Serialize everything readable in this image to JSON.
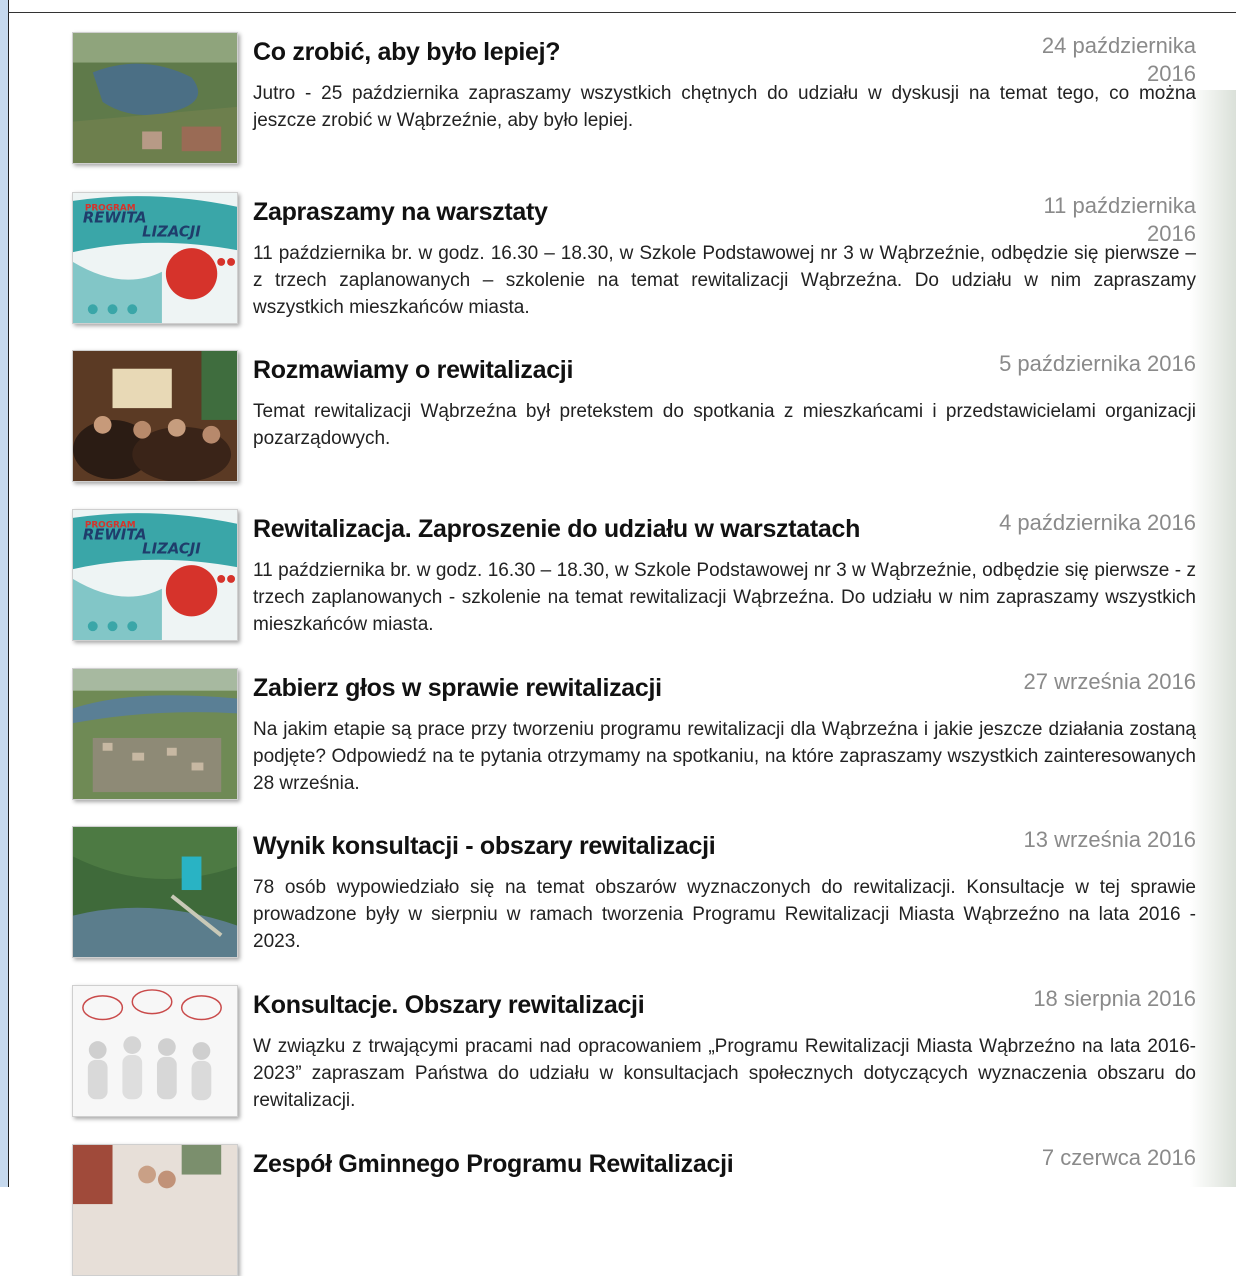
{
  "news": [
    {
      "title": "Co zrobić, aby było lepiej?",
      "date": "24 października 2016",
      "excerpt": "Jutro - 25 października zapraszamy wszystkich chętnych do udziału w dyskusji na temat tego, co można jeszcze zrobić w Wąbrzeźnie, aby było lepiej.",
      "thumbnail": "aerial-lake-town"
    },
    {
      "title": "Zapraszamy na warsztaty",
      "date": "11 października 2016",
      "excerpt": "11 października br. w godz. 16.30 – 18.30, w Szkole Podstawowej nr 3 w Wąbrzeźnie, odbędzie się pierwsze – z trzech zaplanowanych – szkolenie na temat rewitalizacji Wąbrzeźna. Do udziału w nim zapraszamy wszystkich mieszkańców miasta.",
      "thumbnail": "program-rewitalizacji-poster",
      "poster_text": [
        "PROGRAM",
        "REWITA",
        "LIZACJI"
      ]
    },
    {
      "title": "Rozmawiamy o rewitalizacji",
      "date": "5 października 2016",
      "excerpt": "Temat rewitalizacji Wąbrzeźna był pretekstem do spotkania z mieszkańcami i przedstawicielami organizacji pozarządowych.",
      "thumbnail": "meeting-room-photo"
    },
    {
      "title": "Rewitalizacja. Zaproszenie do udziału w warsztatach",
      "date": "4 października 2016",
      "excerpt": "11 października br. w godz. 16.30 – 18.30, w Szkole Podstawowej nr 3 w Wąbrzeźnie, odbędzie się pierwsze - z trzech zaplanowanych - szkolenie na temat rewitalizacji Wąbrzeźna. Do udziału w nim zapraszamy wszystkich mieszkańców miasta.",
      "thumbnail": "program-rewitalizacji-poster",
      "poster_text": [
        "PROGRAM",
        "REWITA",
        "LIZACJI"
      ]
    },
    {
      "title": "Zabierz głos w sprawie rewitalizacji",
      "date": "27 września 2016",
      "excerpt": "Na jakim etapie są prace przy tworzeniu programu rewitalizacji dla Wąbrzeźna i jakie jeszcze działania zostaną podjęte? Odpowiedź na te pytania otrzymamy na spotkaniu, na które zapraszamy wszystkich zainteresowanych 28 września.",
      "thumbnail": "aerial-town-lake"
    },
    {
      "title": "Wynik konsultacji - obszary rewitalizacji",
      "date": "13 września 2016",
      "excerpt": "78 osób wypowiedziało się na temat obszarów wyznaczonych do rewitalizacji. Konsultacje w tej sprawie prowadzone były w sierpniu w ramach tworzenia Programu Rewitalizacji Miasta Wąbrzeźno na lata 2016 - 2023.",
      "thumbnail": "aerial-lakeshore-park"
    },
    {
      "title": "Konsultacje. Obszary rewitalizacji",
      "date": "18 sierpnia 2016",
      "excerpt": "W związku z trwającymi pracami nad opracowaniem „Programu Rewitalizacji Miasta Wąbrzeźno na lata 2016-2023” zapraszam Państwa do udziału w konsultacjach społecznych dotyczących wyznaczenia obszaru do rewitalizacji.",
      "thumbnail": "speech-bubbles-figures"
    },
    {
      "title": "Zespół Gminnego Programu Rewitalizacji",
      "date": "7 czerwca 2016",
      "excerpt": "",
      "thumbnail": "team-photo"
    }
  ]
}
